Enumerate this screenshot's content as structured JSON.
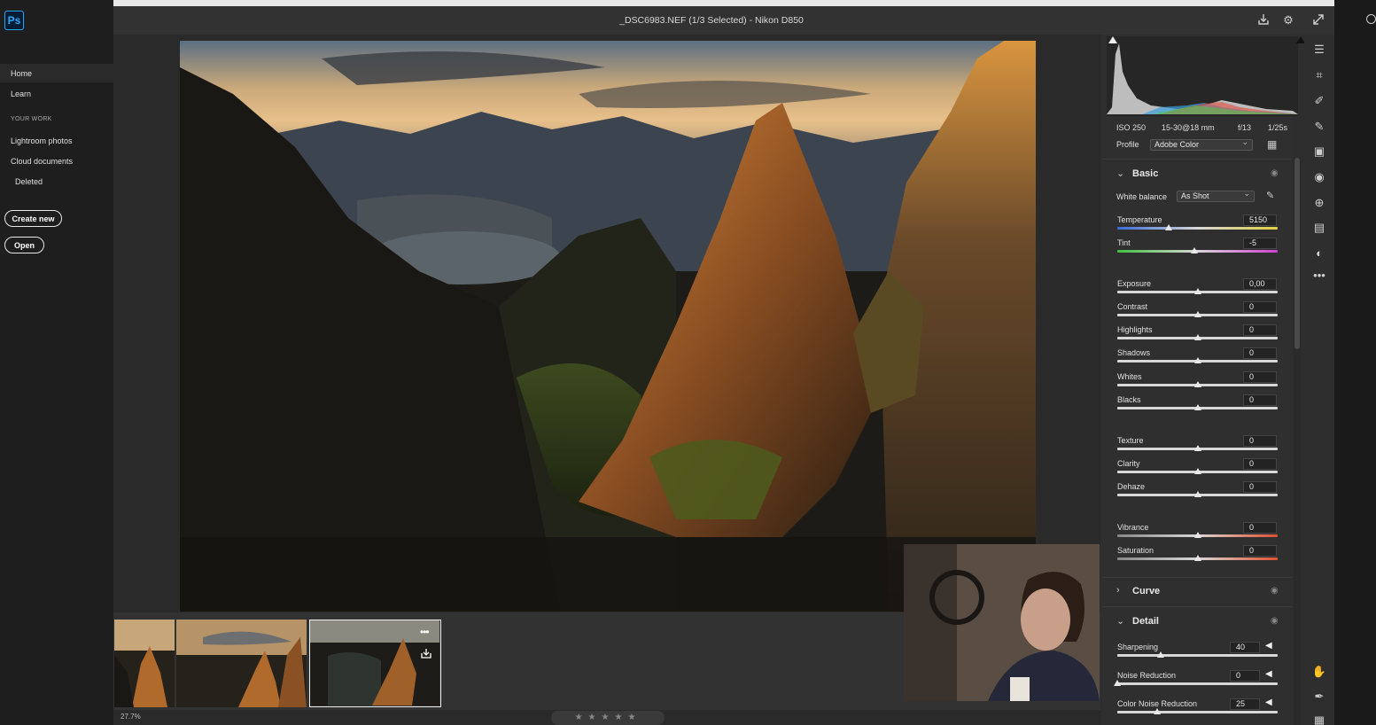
{
  "sidebar": {
    "logo": "Ps",
    "items": [
      {
        "label": "Home"
      },
      {
        "label": "Learn"
      }
    ],
    "section_title": "YOUR WORK",
    "work_items": [
      {
        "label": "Lightroom photos"
      },
      {
        "label": "Cloud documents"
      },
      {
        "label": "Deleted"
      }
    ],
    "create_label": "Create new",
    "open_label": "Open"
  },
  "dialog": {
    "title": "_DSC6983.NEF (1/3 Selected)  -  Nikon D850",
    "icons": [
      "save-icon",
      "gear-icon",
      "fullscreen-icon"
    ]
  },
  "camera_info": {
    "iso": "ISO 250",
    "lens": "15-30@18 mm",
    "aperture": "f/13",
    "shutter": "1/25s"
  },
  "profile": {
    "label": "Profile",
    "value": "Adobe Color"
  },
  "basic": {
    "title": "Basic",
    "white_balance_label": "White balance",
    "white_balance_value": "As Shot",
    "sliders": [
      {
        "label": "Temperature",
        "value": "5150",
        "pos": 0.32
      },
      {
        "label": "Tint",
        "value": "-5",
        "pos": 0.48
      },
      {
        "label": "Exposure",
        "value": "0,00",
        "pos": 0.5
      },
      {
        "label": "Contrast",
        "value": "0",
        "pos": 0.5
      },
      {
        "label": "Highlights",
        "value": "0",
        "pos": 0.5
      },
      {
        "label": "Shadows",
        "value": "0",
        "pos": 0.5
      },
      {
        "label": "Whites",
        "value": "0",
        "pos": 0.5
      },
      {
        "label": "Blacks",
        "value": "0",
        "pos": 0.5
      },
      {
        "label": "Texture",
        "value": "0",
        "pos": 0.5
      },
      {
        "label": "Clarity",
        "value": "0",
        "pos": 0.5
      },
      {
        "label": "Dehaze",
        "value": "0",
        "pos": 0.5
      },
      {
        "label": "Vibrance",
        "value": "0",
        "pos": 0.5
      },
      {
        "label": "Saturation",
        "value": "0",
        "pos": 0.5
      }
    ]
  },
  "curve": {
    "title": "Curve"
  },
  "detail": {
    "title": "Detail",
    "sliders": [
      {
        "label": "Sharpening",
        "value": "40",
        "pos": 0.27
      },
      {
        "label": "Noise Reduction",
        "value": "0",
        "pos": 0.0
      },
      {
        "label": "Color Noise Reduction",
        "value": "25",
        "pos": 0.25
      }
    ]
  },
  "bottom": {
    "zoom": "27.7%",
    "stars": "★★★★★"
  },
  "tools": [
    "edit-icon",
    "crop-icon",
    "heal-icon",
    "brush-icon",
    "gradient-icon",
    "radial-icon",
    "red-eye-icon",
    "snapshots-icon",
    "presets-icon",
    "more-icon",
    "hand-icon",
    "sampler-icon",
    "grid-icon"
  ]
}
